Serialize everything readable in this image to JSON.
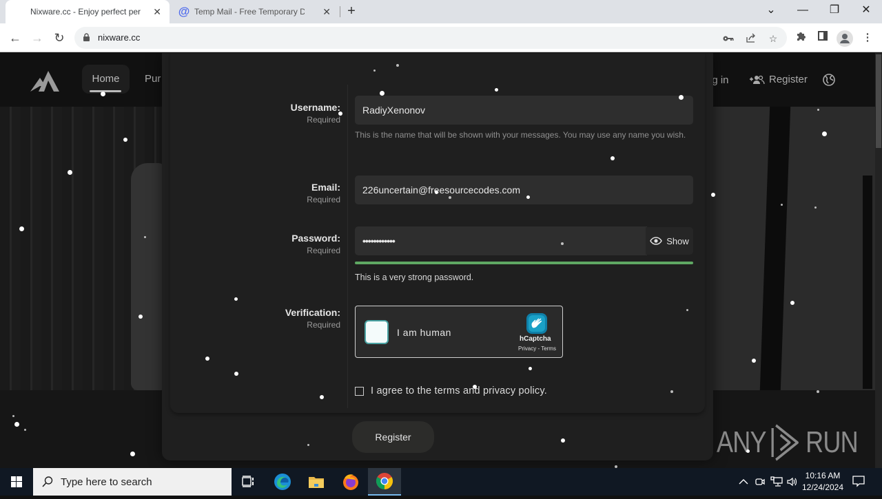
{
  "browser": {
    "tabs": [
      {
        "title": "Nixware.cc - Enjoy perfect perfo",
        "active": true
      },
      {
        "title": "Temp Mail - Free Temporary Disp",
        "active": false,
        "favicon": "at-sign-icon"
      }
    ],
    "new_tab": "+",
    "window_controls": {
      "dropdown": "⌄",
      "minimize": "—",
      "maximize": "❐",
      "close": "✕"
    },
    "url": "nixware.cc",
    "nav": {
      "back": "←",
      "forward": "→",
      "reload": "↻"
    }
  },
  "site": {
    "nav": {
      "home": "Home",
      "purchase_partial": "Pur",
      "login_partial": "og in",
      "register": "Register"
    },
    "watermark": {
      "left": "ANY",
      "right": "RUN"
    }
  },
  "form": {
    "username": {
      "label": "Username:",
      "required": "Required",
      "value": "RadiyXenonov",
      "hint": "This is the name that will be shown with your messages. You may use any name you wish."
    },
    "email": {
      "label": "Email:",
      "required": "Required",
      "value": "226uncertain@freesourcecodes.com"
    },
    "password": {
      "label": "Password:",
      "required": "Required",
      "value": "••••••••••••",
      "show_label": "Show",
      "strength_fraction": 1.0,
      "strength_color": "#5fa863",
      "strength_text": "This is a very strong password."
    },
    "verification": {
      "label": "Verification:",
      "required": "Required",
      "captcha_text": "I am human",
      "captcha_brand": "hCaptcha",
      "captcha_links": "Privacy - Terms"
    },
    "agree_text": "I agree to the terms and privacy policy.",
    "agree_checked": false,
    "submit_label": "Register"
  },
  "taskbar": {
    "search_placeholder": "Type here to search",
    "time": "10:16 AM",
    "date": "12/24/2024"
  }
}
